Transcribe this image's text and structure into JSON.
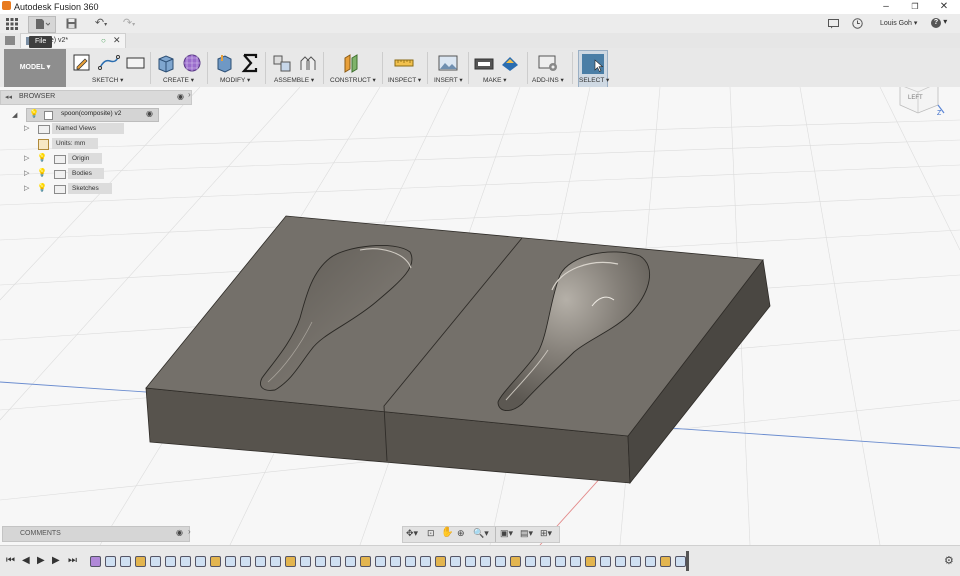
{
  "app": {
    "window_title": "Autodesk Fusion 360",
    "tooltip": "File",
    "user": "Louis Goh",
    "help": "?"
  },
  "document_tab": {
    "label": "s...ite) v2*"
  },
  "ribbon": {
    "workspace": "MODEL",
    "groups": [
      {
        "label": "SKETCH"
      },
      {
        "label": "CREATE"
      },
      {
        "label": "MODIFY"
      },
      {
        "label": "ASSEMBLE"
      },
      {
        "label": "CONSTRUCT"
      },
      {
        "label": "INSPECT"
      },
      {
        "label": "INSERT"
      },
      {
        "label": "MAKE"
      },
      {
        "label": "ADD-INS"
      },
      {
        "label": "SELECT"
      }
    ]
  },
  "browser": {
    "title": "BROWSER",
    "root": "spoon(composite) v2",
    "items": [
      {
        "label": "Named Views"
      },
      {
        "label": "Units: mm"
      },
      {
        "label": "Origin"
      },
      {
        "label": "Bodies"
      },
      {
        "label": "Sketches"
      }
    ]
  },
  "comments": {
    "title": "COMMENTS"
  },
  "viewcube": {
    "face": "LEFT",
    "axis": "Z"
  },
  "colors": {
    "accent": "#4b7fb5",
    "mold_top": "#74706a",
    "mold_side": "#57534d",
    "select_blue": "#4a7ea6"
  }
}
